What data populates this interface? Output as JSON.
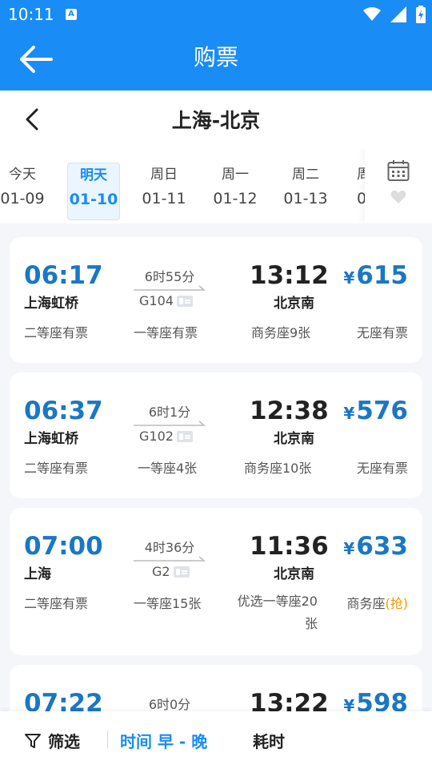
{
  "status": {
    "time": "10:11",
    "notif": "A"
  },
  "header": {
    "title": "购票"
  },
  "route": {
    "title": "上海-北京"
  },
  "dates": [
    {
      "day": "今天",
      "date": "01-09",
      "active": false
    },
    {
      "day": "明天",
      "date": "01-10",
      "active": true
    },
    {
      "day": "周日",
      "date": "01-11",
      "active": false
    },
    {
      "day": "周一",
      "date": "01-12",
      "active": false
    },
    {
      "day": "周二",
      "date": "01-13",
      "active": false
    },
    {
      "day": "周",
      "date": "0",
      "active": false
    }
  ],
  "trains": [
    {
      "dep_time": "06:17",
      "dep_station": "上海虹桥",
      "duration": "6时55分",
      "train_no": "G104",
      "arr_time": "13:12",
      "arr_station": "北京南",
      "currency": "¥",
      "price": "615",
      "seats": [
        "二等座有票",
        "一等座有票",
        "商务座9张",
        "无座有票"
      ]
    },
    {
      "dep_time": "06:37",
      "dep_station": "上海虹桥",
      "duration": "6时1分",
      "train_no": "G102",
      "arr_time": "12:38",
      "arr_station": "北京南",
      "currency": "¥",
      "price": "576",
      "seats": [
        "二等座有票",
        "一等座4张",
        "商务座10张",
        "无座有票"
      ]
    },
    {
      "dep_time": "07:00",
      "dep_station": "上海",
      "duration": "4时36分",
      "train_no": "G2",
      "arr_time": "11:36",
      "arr_station": "北京南",
      "currency": "¥",
      "price": "633",
      "seats": [
        "二等座有票",
        "一等座15张",
        "优选一等座20张",
        "商务座"
      ],
      "seat4_tag": "(抢)"
    },
    {
      "dep_time": "07:22",
      "dep_station": "",
      "duration": "6时0分",
      "train_no": "",
      "arr_time": "13:22",
      "arr_station": "",
      "currency": "¥",
      "price": "598",
      "seats": [
        "",
        "",
        "",
        ""
      ]
    }
  ],
  "bottom": {
    "filter": "筛选",
    "sort_time": "时间 早 - 晚",
    "sort_duration": "耗时"
  },
  "colors": {
    "primary": "#1a8cf5",
    "accent_orange": "#f39800",
    "time_blue": "#1a77c4"
  }
}
